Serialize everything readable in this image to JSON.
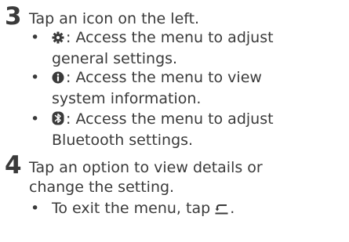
{
  "steps": [
    {
      "number": "3",
      "text": "Tap an icon on the left.",
      "bullets": [
        {
          "icon": "gear-icon",
          "text_line1": ": Access the menu to adjust",
          "text_line2": "general settings."
        },
        {
          "icon": "info-icon",
          "text_line1": ": Access the menu to view",
          "text_line2": "system information."
        },
        {
          "icon": "bluetooth-icon",
          "text_line1": ": Access the menu to adjust",
          "text_line2": "Bluetooth settings."
        }
      ]
    },
    {
      "number": "4",
      "text_line1": "Tap an option to view details or",
      "text_line2": "change the setting.",
      "bullets": [
        {
          "text_before_icon": "To exit the menu, tap",
          "icon": "back-icon",
          "text_after_icon": "."
        }
      ]
    }
  ],
  "bullet_symbol": "•"
}
